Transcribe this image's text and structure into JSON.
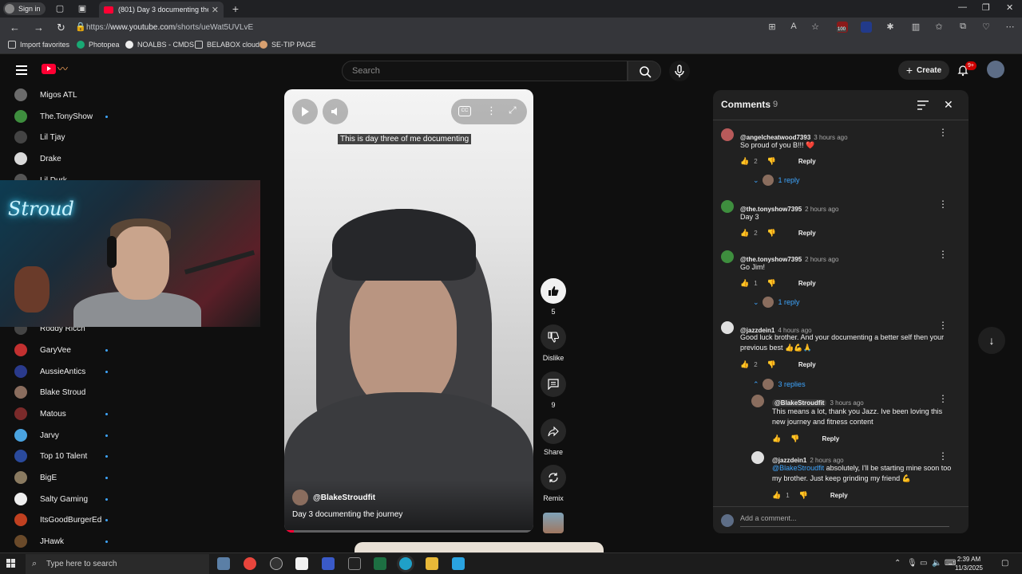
{
  "browser": {
    "signin_label": "Sign in",
    "tab_title": "(801) Day 3 documenting the jou",
    "url_scheme": "https://",
    "url_host": "www.youtube.com",
    "url_path": "/shorts/ueWat5UVLvE",
    "bookmarks": [
      "Import favorites",
      "Photopea",
      "NOALBS - CMDS",
      "BELABOX cloud",
      "SE-TIP PAGE"
    ],
    "ext_badge": "100"
  },
  "header": {
    "search_placeholder": "Search",
    "create_label": "Create",
    "notif_badge": "9+"
  },
  "sidebar": {
    "items": [
      {
        "label": "Migos ATL",
        "color": "#6b6b6b",
        "dot": false
      },
      {
        "label": "The.TonyShow",
        "color": "#3e8e3e",
        "dot": true
      },
      {
        "label": "Lil Tjay",
        "color": "#444",
        "dot": false
      },
      {
        "label": "Drake",
        "color": "#d9d9d9",
        "dot": false
      },
      {
        "label": "Lil Durk",
        "color": "#555",
        "dot": false
      },
      {
        "label": "Roddy Ricch",
        "color": "#444",
        "dot": false
      },
      {
        "label": "GaryVee",
        "color": "#c23030",
        "dot": true
      },
      {
        "label": "AussieAntics",
        "color": "#2a3a8c",
        "dot": true
      },
      {
        "label": "Blake Stroud",
        "color": "#8a6d5e",
        "dot": false
      },
      {
        "label": "Matous",
        "color": "#7a2a2a",
        "dot": true
      },
      {
        "label": "Jarvy",
        "color": "#4aa3e0",
        "dot": true
      },
      {
        "label": "Top 10 Talent",
        "color": "#2a4a9c",
        "dot": true
      },
      {
        "label": "BigE",
        "color": "#8a7a60",
        "dot": true
      },
      {
        "label": "Salty Gaming",
        "color": "#eeeeee",
        "dot": true
      },
      {
        "label": "ItsGoodBurgerEd",
        "color": "#c04020",
        "dot": true
      },
      {
        "label": "JHawk",
        "color": "#6a4a2a",
        "dot": true
      }
    ]
  },
  "webcam": {
    "neon_text": "Stroud"
  },
  "player": {
    "caption": "This is day three of me documenting",
    "channel": "@BlakeStroudfit",
    "title": "Day 3 documenting the journey",
    "progress": 0.04,
    "cc_label": "CC"
  },
  "actions": {
    "like_count": "5",
    "dislike_label": "Dislike",
    "comment_count": "9",
    "share_label": "Share",
    "remix_label": "Remix"
  },
  "comments": {
    "title": "Comments",
    "count": "9",
    "reply_label": "Reply",
    "add_placeholder": "Add a comment...",
    "items": [
      {
        "author": "@angelcheatwood7393",
        "time": "3 hours ago",
        "text": "So proud of you B!!! ❤️",
        "likes": "2",
        "replies": "1 reply",
        "av": "#b85a5a"
      },
      {
        "author": "@the.tonyshow7395",
        "time": "2 hours ago",
        "text": "Day 3",
        "likes": "2",
        "replies": "",
        "av": "#3e8e3e"
      },
      {
        "author": "@the.tonyshow7395",
        "time": "2 hours ago",
        "text": "Go Jim!",
        "likes": "1",
        "replies": "1 reply",
        "av": "#3e8e3e"
      },
      {
        "author": "@jazzdein1",
        "time": "4 hours ago",
        "text": "Good luck brother. And your documenting a better self then your previous best 👍💪🙏",
        "likes": "2",
        "replies": "3 replies",
        "av": "#e0e0e0"
      }
    ],
    "thread": [
      {
        "author": "@BlakeStroudfit",
        "time": "3 hours ago",
        "text": "This means a lot, thank you Jazz. Ive been loving this new journey and fitness content",
        "likes": ""
      },
      {
        "author": "@jazzdein1",
        "time": "2 hours ago",
        "mention": "@BlakeStroudfit",
        "text": " absolutely, I'll be starting mine soon too my brother. Just keep grinding my friend 💪",
        "likes": "1"
      }
    ]
  },
  "taskbar": {
    "search_placeholder": "Type here to search",
    "time": "2:39 AM",
    "date": "11/3/2025"
  }
}
